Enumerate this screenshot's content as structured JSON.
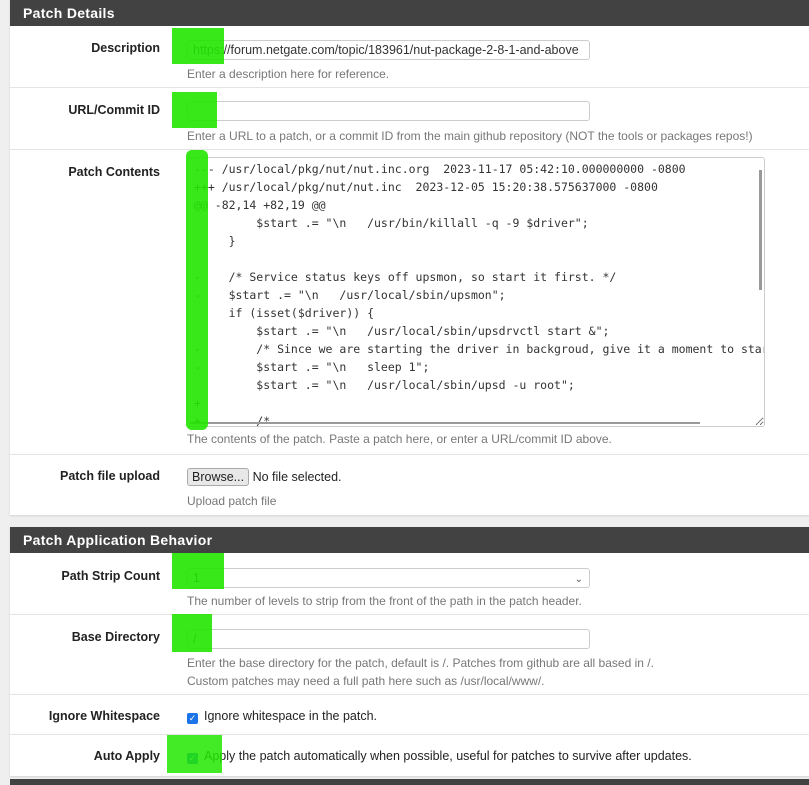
{
  "patch_details": {
    "header": "Patch Details",
    "description": {
      "label": "Description",
      "value": "https://forum.netgate.com/topic/183961/nut-package-2-8-1-and-above",
      "help": "Enter a description here for reference."
    },
    "url_commit": {
      "label": "URL/Commit ID",
      "value": "",
      "help": "Enter a URL to a patch, or a commit ID from the main github repository (NOT the tools or packages repos!)"
    },
    "patch_contents": {
      "label": "Patch Contents",
      "value": "--- /usr/local/pkg/nut/nut.inc.org  2023-11-17 05:42:10.000000000 -0800\n+++ /usr/local/pkg/nut/nut.inc  2023-12-05 15:20:38.575637000 -0800\n@@ -82,14 +82,19 @@\n         $start .= \"\\n   /usr/bin/killall -q -9 $driver\";\n     }\n\n-    /* Service status keys off upsmon, so start it first. */\n-    $start .= \"\\n   /usr/local/sbin/upsmon\";\n     if (isset($driver)) {\n         $start .= \"\\n   /usr/local/sbin/upsdrvctl start &\";\n-        /* Since we are starting the driver in backgroud, give it a moment to start */\n-        $start .= \"\\n   sleep 1\";\n         $start .= \"\\n   /usr/local/sbin/upsd -u root\";\n+\n+        /*",
      "help": "The contents of the patch. Paste a patch here, or enter a URL/commit ID above."
    },
    "upload": {
      "label": "Patch file upload",
      "button": "Browse...",
      "status": "No file selected.",
      "help": "Upload patch file"
    }
  },
  "behavior": {
    "header": "Patch Application Behavior",
    "path_strip": {
      "label": "Path Strip Count",
      "value": "1",
      "help": "The number of levels to strip from the front of the path in the patch header."
    },
    "base_dir": {
      "label": "Base Directory",
      "value": "/",
      "help1": "Enter the base directory for the patch, default is /. Patches from github are all based in /.",
      "help2": "Custom patches may need a full path here such as /usr/local/www/."
    },
    "ignore_ws": {
      "label": "Ignore Whitespace",
      "checked": true,
      "text": "Ignore whitespace in the patch."
    },
    "auto_apply": {
      "label": "Auto Apply",
      "checked": true,
      "text": "Apply the patch automatically when possible, useful for patches to survive after updates."
    }
  },
  "colors": {
    "header_bg": "#424242",
    "checkbox": "#1a73e8",
    "highlight": "#22e600"
  }
}
